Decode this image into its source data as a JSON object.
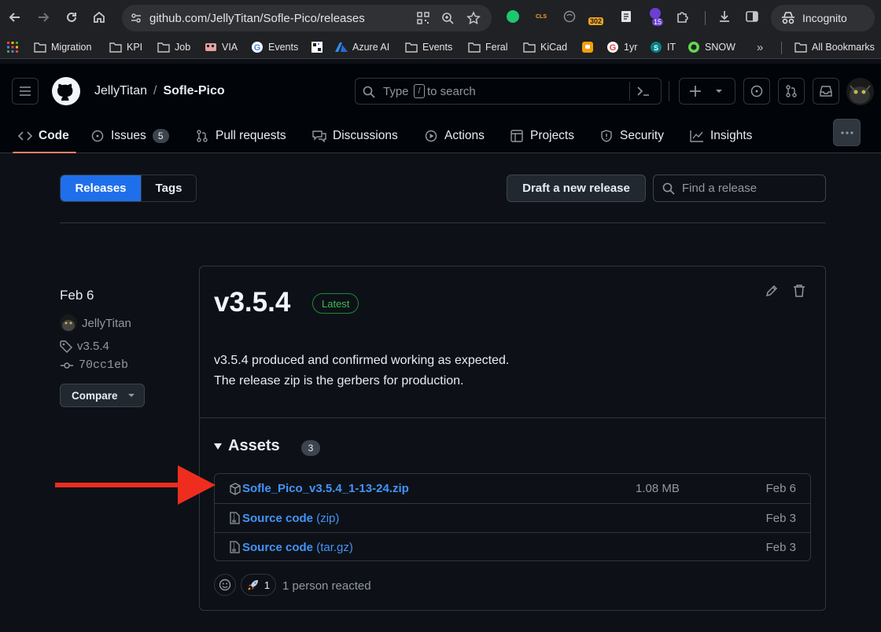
{
  "browser": {
    "url": "github.com/JellyTitan/Sofle-Pico/releases",
    "badges": {
      "cls": "CLS",
      "count302": "302",
      "count15": "15"
    },
    "incognito_label": "Incognito"
  },
  "bookmarks": {
    "items": [
      "Migration",
      "KPI",
      "Job",
      "VIA",
      "Events",
      "",
      "Azure AI",
      "Events",
      "Feral",
      "KiCad",
      "",
      "1yr",
      "IT",
      "SNOW"
    ],
    "all_label": "All Bookmarks"
  },
  "header": {
    "owner": "JellyTitan",
    "sep": "/",
    "repo": "Sofle-Pico",
    "search_type": "Type",
    "search_key": "/",
    "search_rest": "to search"
  },
  "tabs": [
    {
      "label": "Code",
      "icon": "code-icon"
    },
    {
      "label": "Issues",
      "icon": "issue-icon",
      "count": "5"
    },
    {
      "label": "Pull requests",
      "icon": "pull-request-icon"
    },
    {
      "label": "Discussions",
      "icon": "discussion-icon"
    },
    {
      "label": "Actions",
      "icon": "play-icon"
    },
    {
      "label": "Projects",
      "icon": "table-icon"
    },
    {
      "label": "Security",
      "icon": "shield-icon"
    },
    {
      "label": "Insights",
      "icon": "graph-icon"
    }
  ],
  "releases_page": {
    "releases_tab": "Releases",
    "tags_tab": "Tags",
    "draft_button": "Draft a new release",
    "find_placeholder": "Find a release"
  },
  "release": {
    "date": "Feb 6",
    "author": "JellyTitan",
    "tag": "v3.5.4",
    "commit": "70cc1eb",
    "compare_label": "Compare",
    "title": "v3.5.4",
    "badge": "Latest",
    "body_line1": "v3.5.4 produced and confirmed working as expected.",
    "body_line2": "The release zip is the gerbers for production.",
    "assets_label": "Assets",
    "assets_count": "3",
    "assets": [
      {
        "name": "Sofle_Pico_v3.5.4_1-13-24.zip",
        "ext": "",
        "size": "1.08 MB",
        "date": "Feb 6",
        "icon": "package-icon"
      },
      {
        "name": "Source code",
        "ext": "(zip)",
        "size": "",
        "date": "Feb 3",
        "icon": "file-zip-icon"
      },
      {
        "name": "Source code",
        "ext": "(tar.gz)",
        "size": "",
        "date": "Feb 3",
        "icon": "file-zip-icon"
      }
    ],
    "rocket_count": "1",
    "reacted_text": "1 person reacted"
  },
  "colors": {
    "accent": "#1f6feb",
    "link": "#4493f8",
    "arrow": "#ee2d1f",
    "latest": "#3fb950"
  }
}
